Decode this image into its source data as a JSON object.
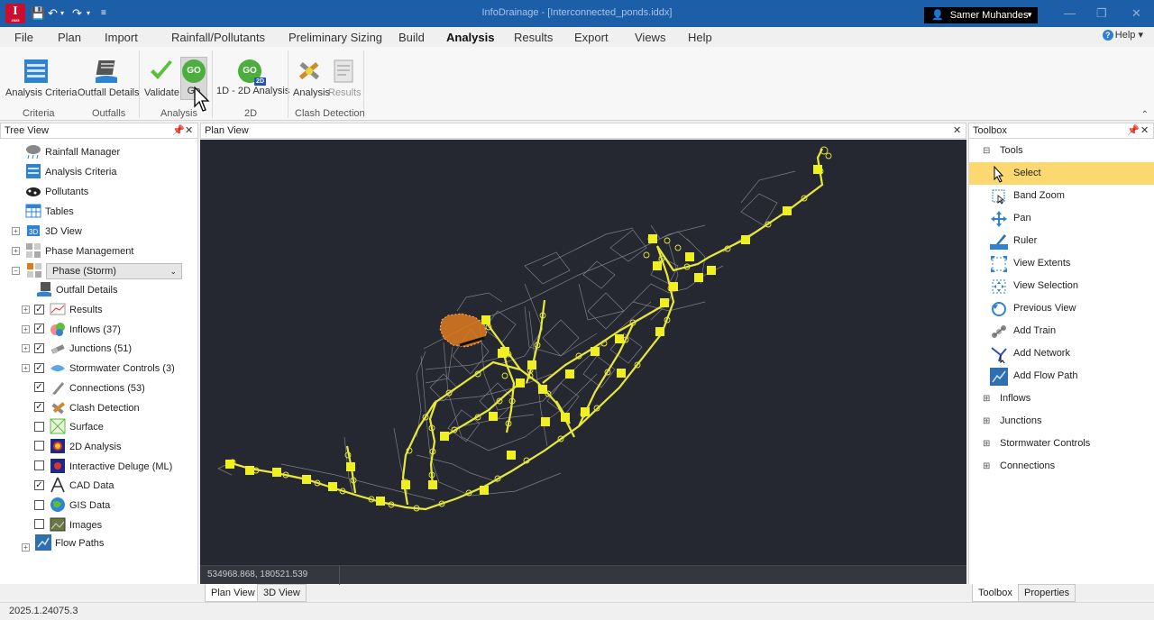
{
  "titlebar": {
    "title": "InfoDrainage - [Interconnected_ponds.iddx]",
    "logo_letter": "I",
    "logo_sub": "2025",
    "user": "Samer Muhandes",
    "qat": [
      "save-icon",
      "undo-icon",
      "redo-icon",
      "customize-icon"
    ]
  },
  "menu": {
    "tabs": [
      "File",
      "Plan",
      "Import",
      "Rainfall/Pollutants",
      "Preliminary Sizing",
      "Build",
      "Analysis",
      "Results",
      "Export",
      "Views",
      "Help"
    ],
    "active": "Analysis",
    "help": "Help"
  },
  "ribbon": {
    "buttons": {
      "analysis_criteria": "Analysis Criteria",
      "outfall_details": "Outfall Details",
      "validate": "Validate",
      "go": "Go",
      "go_1d2d": "1D - 2D Analysis",
      "clash_analysis": "Analysis",
      "clash_results": "Results"
    },
    "groups": {
      "criteria": "Criteria",
      "outfalls": "Outfalls",
      "analysis": "Analysis",
      "twod": "2D",
      "clash": "Clash Detection"
    },
    "go_badge": "GO",
    "badge_2d": "2D"
  },
  "treeview": {
    "title": "Tree View",
    "items": [
      "Rainfall Manager",
      "Analysis Criteria",
      "Pollutants",
      "Tables",
      "3D View",
      "Phase Management"
    ],
    "phase": "Phase (Storm)",
    "phase_items": [
      {
        "label": "Outfall Details",
        "checked": null
      },
      {
        "label": "Results",
        "checked": true
      },
      {
        "label": "Inflows (37)",
        "checked": true
      },
      {
        "label": "Junctions (51)",
        "checked": true
      },
      {
        "label": "Stormwater Controls (3)",
        "checked": true
      },
      {
        "label": "Connections (53)",
        "checked": true
      },
      {
        "label": "Clash Detection",
        "checked": true
      },
      {
        "label": "Surface",
        "checked": false
      },
      {
        "label": "2D Analysis",
        "checked": false
      },
      {
        "label": "Interactive Deluge (ML)",
        "checked": false
      },
      {
        "label": "CAD Data",
        "checked": true
      },
      {
        "label": "GIS Data",
        "checked": false
      },
      {
        "label": "Images",
        "checked": false
      }
    ],
    "last": "Flow Paths"
  },
  "planview": {
    "title": "Plan View",
    "coords": "534968.868, 180521.539",
    "tabs": [
      "Plan View",
      "3D View"
    ]
  },
  "toolbox": {
    "title": "Toolbox",
    "group": "Tools",
    "tools": [
      "Select",
      "Band Zoom",
      "Pan",
      "Ruler",
      "View Extents",
      "View Selection",
      "Previous View",
      "Add Train",
      "Add Network",
      "Add Flow Path"
    ],
    "groups": [
      "Inflows",
      "Junctions",
      "Stormwater Controls",
      "Connections"
    ],
    "tabs": [
      "Toolbox",
      "Properties"
    ],
    "selected": "Select"
  },
  "status": {
    "version": "2025.1.24075.3"
  },
  "colors": {
    "titlebar": "#1d5ea8",
    "canvas": "#252830",
    "network": "#e8e83a",
    "pond": "#e07a1f",
    "selection": "#fbd970"
  }
}
